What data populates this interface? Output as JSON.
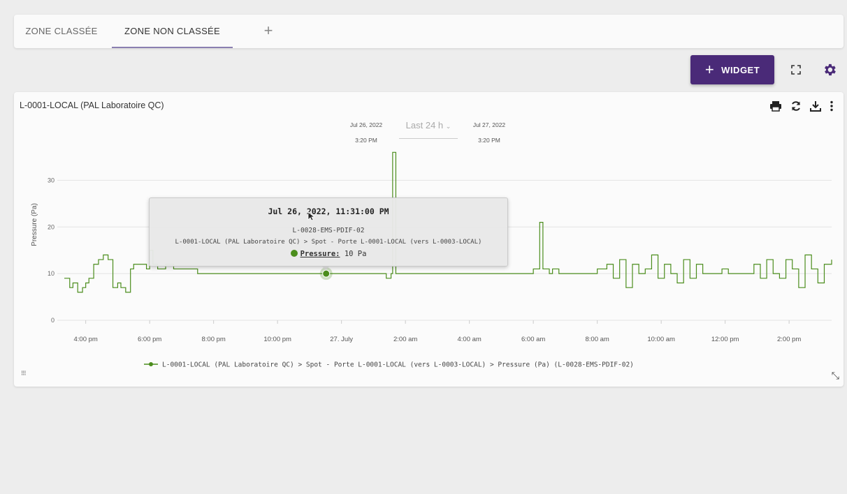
{
  "tabs": [
    {
      "label": "ZONE CLASSÉE",
      "active": false
    },
    {
      "label": "ZONE NON CLASSÉE",
      "active": true
    }
  ],
  "add_tab_icon": "plus-icon",
  "toolbar": {
    "widget_label": "WIDGET",
    "icons": [
      "plus-icon",
      "fullscreen-icon",
      "gear-icon"
    ],
    "accent_color": "#4a2a78"
  },
  "card": {
    "title": "L-0001-LOCAL (PAL Laboratoire QC)",
    "icons": [
      "print-icon",
      "refresh-icon",
      "download-icon",
      "more-vert-icon"
    ],
    "range": {
      "from_date": "Jul 26, 2022",
      "from_time": "3:20 PM",
      "selection": "Last 24 h",
      "to_date": "Jul 27, 2022",
      "to_time": "3:20 PM"
    }
  },
  "tooltip": {
    "date": "Jul 26, 2022, 11:31:00 PM",
    "device": "L-0028-EMS-PDIF-02",
    "path": "L-0001-LOCAL (PAL Laboratoire QC) > Spot - Porte L-0001-LOCAL (vers L-0003-LOCAL)",
    "label": "Pressure:",
    "value": "10 Pa"
  },
  "chart_data": {
    "type": "line",
    "title": "",
    "xlabel": "",
    "ylabel": "Pressure (Pa)",
    "x_tick_labels": [
      "4:00 pm",
      "6:00 pm",
      "8:00 pm",
      "10:00 pm",
      "27. July",
      "2:00 am",
      "4:00 am",
      "6:00 am",
      "8:00 am",
      "10:00 am",
      "12:00 pm",
      "2:00 pm"
    ],
    "x_tick_hours": [
      16,
      18,
      20,
      22,
      24,
      26,
      28,
      30,
      32,
      34,
      36,
      38
    ],
    "xlim_hours": [
      15.33,
      39.33
    ],
    "y_ticks": [
      0,
      10,
      20,
      30
    ],
    "ylim": [
      0,
      35
    ],
    "grid": true,
    "legend_position": "bottom",
    "color": "#4b8d1c",
    "highlight": {
      "hour": 23.52,
      "value": 10
    },
    "series": [
      {
        "name": "L-0001-LOCAL (PAL Laboratoire QC) > Spot - Porte L-0001-LOCAL (vers L-0003-LOCAL) > Pressure (Pa) (L-0028-EMS-PDIF-02)",
        "hours": [
          15.33,
          15.5,
          15.6,
          15.75,
          15.9,
          16.0,
          16.1,
          16.25,
          16.4,
          16.55,
          16.7,
          16.85,
          17.0,
          17.1,
          17.25,
          17.4,
          17.5,
          17.6,
          17.75,
          17.9,
          18.0,
          18.1,
          18.25,
          18.5,
          18.75,
          19.0,
          19.5,
          20.0,
          20.5,
          21.0,
          21.5,
          22.0,
          22.5,
          23.0,
          23.52,
          24.0,
          24.5,
          25.0,
          25.4,
          25.55,
          25.6,
          25.7,
          25.8,
          26.0,
          26.5,
          27.0,
          27.5,
          28.0,
          28.5,
          29.0,
          29.5,
          30.0,
          30.2,
          30.3,
          30.5,
          30.6,
          30.8,
          31.0,
          31.5,
          32.0,
          32.3,
          32.5,
          32.7,
          32.9,
          33.1,
          33.3,
          33.5,
          33.7,
          33.9,
          34.1,
          34.3,
          34.5,
          34.7,
          34.9,
          35.1,
          35.3,
          35.5,
          35.7,
          35.9,
          36.1,
          36.3,
          36.5,
          36.7,
          36.9,
          37.1,
          37.3,
          37.5,
          37.7,
          37.9,
          38.1,
          38.3,
          38.5,
          38.7,
          38.9,
          39.1,
          39.33
        ],
        "values": [
          9,
          7,
          8,
          6,
          7,
          8,
          9,
          12,
          13,
          14,
          13,
          7,
          8,
          7,
          6,
          11,
          12,
          12,
          12,
          11,
          15,
          12,
          11,
          12,
          11,
          11,
          10,
          10,
          10,
          10,
          10,
          10,
          10,
          10,
          10,
          10,
          10,
          10,
          9,
          10,
          36,
          10,
          10,
          10,
          10,
          10,
          10,
          10,
          10,
          10,
          10,
          11,
          21,
          11,
          10,
          11,
          10,
          10,
          10,
          11,
          12,
          9,
          13,
          7,
          12,
          10,
          11,
          14,
          9,
          12,
          10,
          8,
          13,
          9,
          12,
          10,
          10,
          10,
          11,
          10,
          10,
          10,
          10,
          12,
          9,
          13,
          10,
          9,
          13,
          11,
          7,
          14,
          11,
          8,
          12,
          13
        ]
      }
    ]
  }
}
